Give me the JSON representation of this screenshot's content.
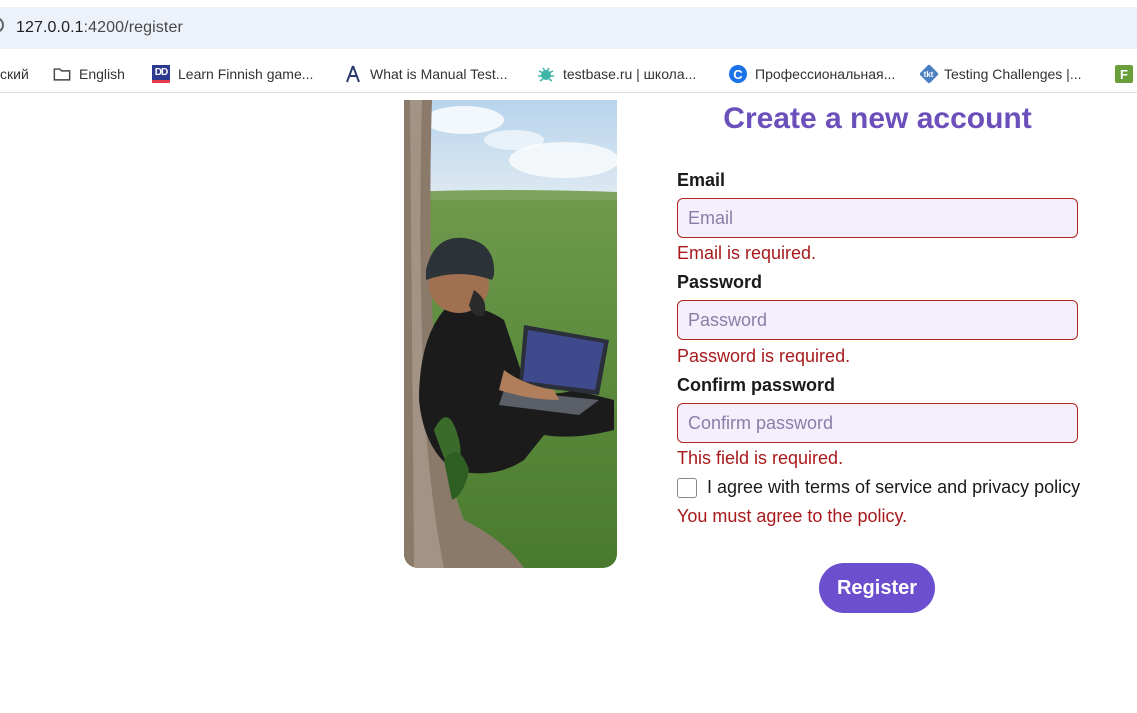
{
  "browser": {
    "url_host": "127.0.0.1",
    "url_path": ":4200/register",
    "bookmarks": [
      {
        "label": "ский",
        "icon": "none"
      },
      {
        "label": "English",
        "icon": "folder-icon"
      },
      {
        "label": "Learn Finnish game...",
        "icon": "dd-icon"
      },
      {
        "label": "What is Manual Test...",
        "icon": "compass-icon"
      },
      {
        "label": "testbase.ru | школа...",
        "icon": "bug-icon"
      },
      {
        "label": "Профессиональная...",
        "icon": "c-icon"
      },
      {
        "label": "Testing Challenges |...",
        "icon": "tkt-icon"
      },
      {
        "label": "",
        "icon": "f-icon"
      }
    ]
  },
  "form": {
    "title": "Create a new account",
    "email": {
      "label": "Email",
      "placeholder": "Email",
      "value": "",
      "error": "Email is required."
    },
    "password": {
      "label": "Password",
      "placeholder": "Password",
      "value": "",
      "error": "Password is required."
    },
    "confirm": {
      "label": "Confirm password",
      "placeholder": "Confirm password",
      "value": "",
      "error": "This field is required."
    },
    "agree": {
      "label": "I agree with terms of service and privacy policy",
      "checked": false,
      "error": "You must agree to the policy."
    },
    "submit_label": "Register"
  },
  "colors": {
    "accent": "#6b4fbb",
    "button": "#6b4fce",
    "error": "#a8191c",
    "input_bg": "#f3effd"
  }
}
